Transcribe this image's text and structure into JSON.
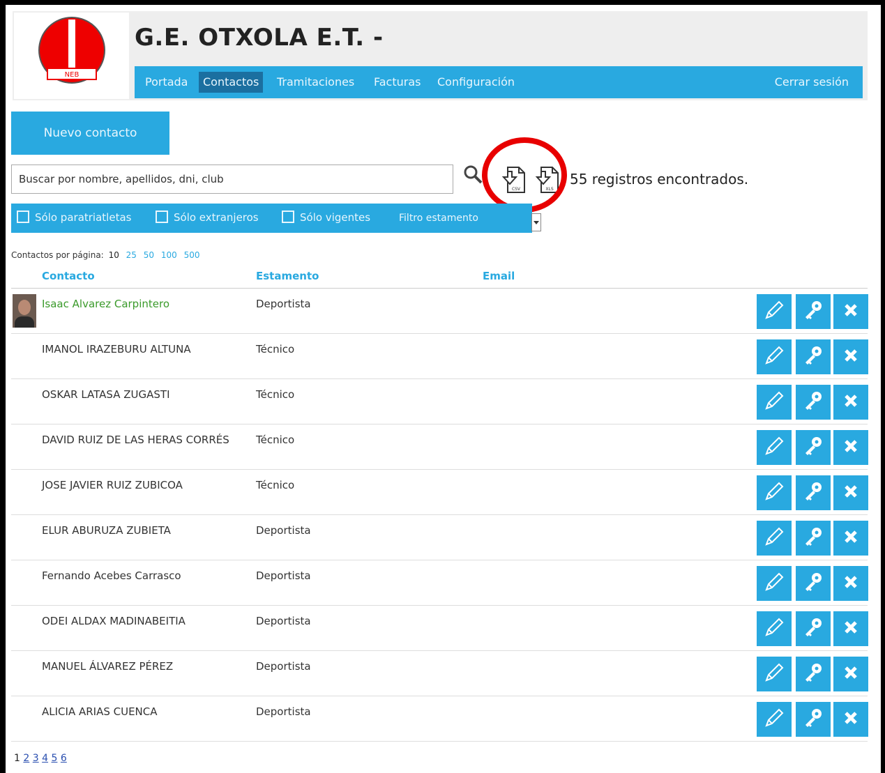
{
  "header": {
    "logo_text": "NEB",
    "title": "G.E. OTXOLA E.T. -"
  },
  "nav": {
    "items": [
      {
        "label": "Portada"
      },
      {
        "label": "Contactos"
      },
      {
        "label": "Tramitaciones"
      },
      {
        "label": "Facturas"
      },
      {
        "label": "Configuración"
      }
    ],
    "active": "Contactos",
    "logout_label": "Cerrar sesión"
  },
  "toolbar": {
    "new_contact_label": "Nuevo contacto",
    "search_placeholder": "Buscar por nombre, apellidos, dni, club",
    "export_csv_label": "CSV",
    "export_xls_label": "XLS",
    "records_text": "55 registros encontrados."
  },
  "filters": {
    "paratriatletas": "Sólo paratriatletas",
    "extranjeros": "Sólo extranjeros",
    "vigentes": "Sólo vigentes",
    "estamento_select": "Filtro estamento"
  },
  "per_page": {
    "label": "Contactos por página:",
    "current": "10",
    "options": [
      "25",
      "50",
      "100",
      "500"
    ]
  },
  "table": {
    "headers": {
      "contact": "Contacto",
      "estamento": "Estamento",
      "email": "Email"
    },
    "rows": [
      {
        "name": "Isaac Alvarez Carpintero",
        "estamento": "Deportista",
        "email": ""
      },
      {
        "name": "IMANOL IRAZEBURU ALTUNA",
        "estamento": "Técnico",
        "email": ""
      },
      {
        "name": "OSKAR LATASA ZUGASTI",
        "estamento": "Técnico",
        "email": ""
      },
      {
        "name": "DAVID RUIZ DE LAS HERAS CORRÉS",
        "estamento": "Técnico",
        "email": ""
      },
      {
        "name": "JOSE JAVIER RUIZ ZUBICOA",
        "estamento": "Técnico",
        "email": ""
      },
      {
        "name": "ELUR ABURUZA ZUBIETA",
        "estamento": "Deportista",
        "email": ""
      },
      {
        "name": "Fernando Acebes Carrasco",
        "estamento": "Deportista",
        "email": ""
      },
      {
        "name": "ODEI ALDAX MADINABEITIA",
        "estamento": "Deportista",
        "email": ""
      },
      {
        "name": "MANUEL ÁLVAREZ PÉREZ",
        "estamento": "Deportista",
        "email": ""
      },
      {
        "name": "ALICIA ARIAS CUENCA",
        "estamento": "Deportista",
        "email": ""
      }
    ]
  },
  "pagination": {
    "current": "1",
    "pages": [
      "2",
      "3",
      "4",
      "5",
      "6"
    ]
  },
  "colors": {
    "accent": "#29a9e0",
    "nav_active": "#1b6fa0",
    "highlight_circle": "#e80000",
    "highlight_name": "#3a9a2a"
  }
}
